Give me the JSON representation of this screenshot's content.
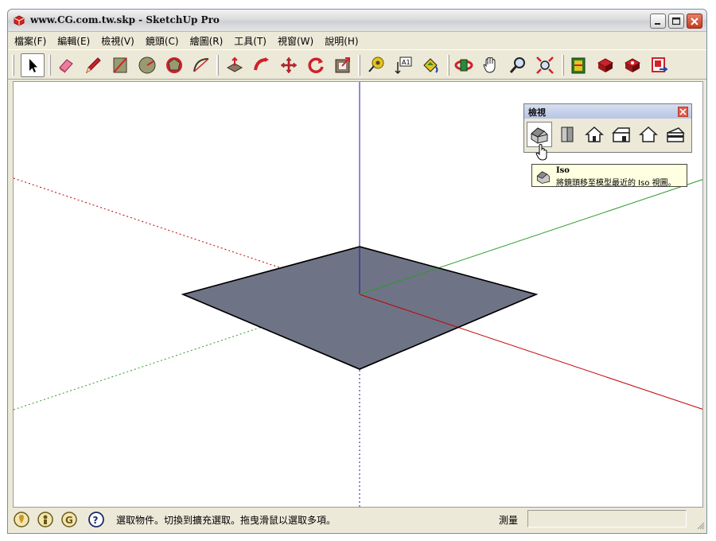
{
  "window": {
    "title": "www.CG.com.tw.skp - SketchUp Pro",
    "controls": {
      "minimize": "minimize-icon",
      "maximize": "maximize-icon",
      "close": "close-icon"
    }
  },
  "menu": {
    "items": [
      {
        "label": "檔案(F)"
      },
      {
        "label": "編輯(E)"
      },
      {
        "label": "檢視(V)"
      },
      {
        "label": "鏡頭(C)"
      },
      {
        "label": "繪圖(R)"
      },
      {
        "label": "工具(T)"
      },
      {
        "label": "視窗(W)"
      },
      {
        "label": "說明(H)"
      }
    ]
  },
  "toolbar": {
    "tools": [
      "select-icon",
      "eraser-icon",
      "pencil-icon",
      "rectangle-icon",
      "circle-icon",
      "polygon-icon",
      "arc-icon",
      "push-pull-icon",
      "follow-me-icon",
      "move-icon",
      "rotate-icon",
      "offset-icon",
      "tape-measure-icon",
      "text-icon",
      "paint-bucket-icon",
      "orbit-icon",
      "pan-icon",
      "zoom-icon",
      "zoom-extents-icon",
      "previous-view-icon",
      "get-models-icon",
      "share-model-icon",
      "send-to-layout-icon"
    ],
    "active_tool": "select"
  },
  "views_panel": {
    "title": "檢視",
    "views": [
      "iso-view-icon",
      "top-view-icon",
      "front-view-icon",
      "right-view-icon",
      "back-view-icon",
      "left-view-icon"
    ],
    "active_view": "iso"
  },
  "tooltip": {
    "title": "Iso",
    "description": "將鏡頭移至模型最近的 Iso 視圖。"
  },
  "statusbar": {
    "icons": [
      "geo-location-icon",
      "credits-icon",
      "google-icon",
      "help-icon"
    ],
    "message": "選取物件。切換到擴充選取。拖曳滑鼠以選取多項。",
    "measure_label": "測量",
    "measure_value": ""
  },
  "colors": {
    "face": "#6f7386",
    "x_axis": "#c00000",
    "y_axis": "#2a9a2a",
    "z_axis": "#1a1aa8",
    "window_bg": "#ece9d8"
  }
}
